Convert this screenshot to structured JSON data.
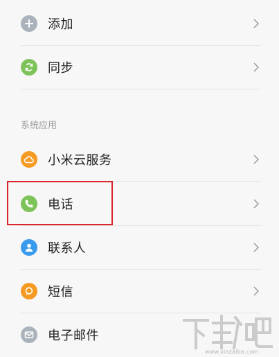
{
  "items": [
    {
      "label": "添加",
      "icon": "plus-icon",
      "color": "#aab2bb"
    },
    {
      "label": "同步",
      "icon": "sync-icon",
      "color": "#7dc35a"
    },
    {
      "label": "小米云服务",
      "icon": "cloud-icon",
      "color": "#f59a23"
    },
    {
      "label": "电话",
      "icon": "phone-icon",
      "color": "#7dc35a"
    },
    {
      "label": "联系人",
      "icon": "person-icon",
      "color": "#3a9bec"
    },
    {
      "label": "短信",
      "icon": "message-icon",
      "color": "#f59a23"
    },
    {
      "label": "电子邮件",
      "icon": "mail-icon",
      "color": "#aab2bb"
    }
  ],
  "section_header": "系统应用",
  "watermark": {
    "logo_text": "下载吧",
    "url": "www.xiazaiba.com"
  },
  "highlight_color": "#d9252b"
}
